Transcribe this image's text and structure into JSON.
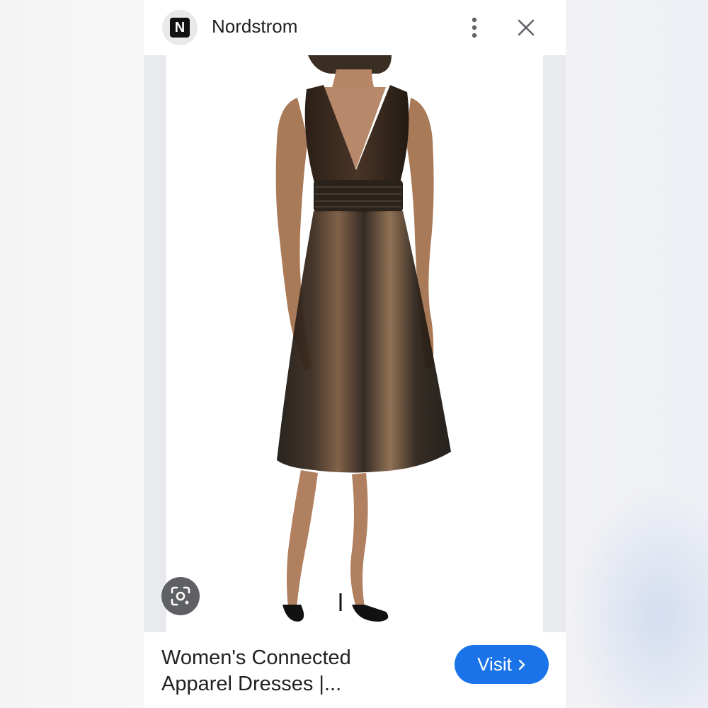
{
  "header": {
    "logo_letter": "N",
    "site_name": "Nordstrom",
    "more_icon": "more-vertical-icon",
    "close_icon": "close-icon"
  },
  "image": {
    "lens_icon": "google-lens-icon"
  },
  "footer": {
    "title_line1": "Women's Connected",
    "title_line2": "Apparel Dresses |...",
    "visit_label": "Visit",
    "visit_icon": "chevron-right-icon"
  },
  "colors": {
    "accent": "#1a73e8",
    "text": "#202124",
    "icon": "#5f6368"
  }
}
